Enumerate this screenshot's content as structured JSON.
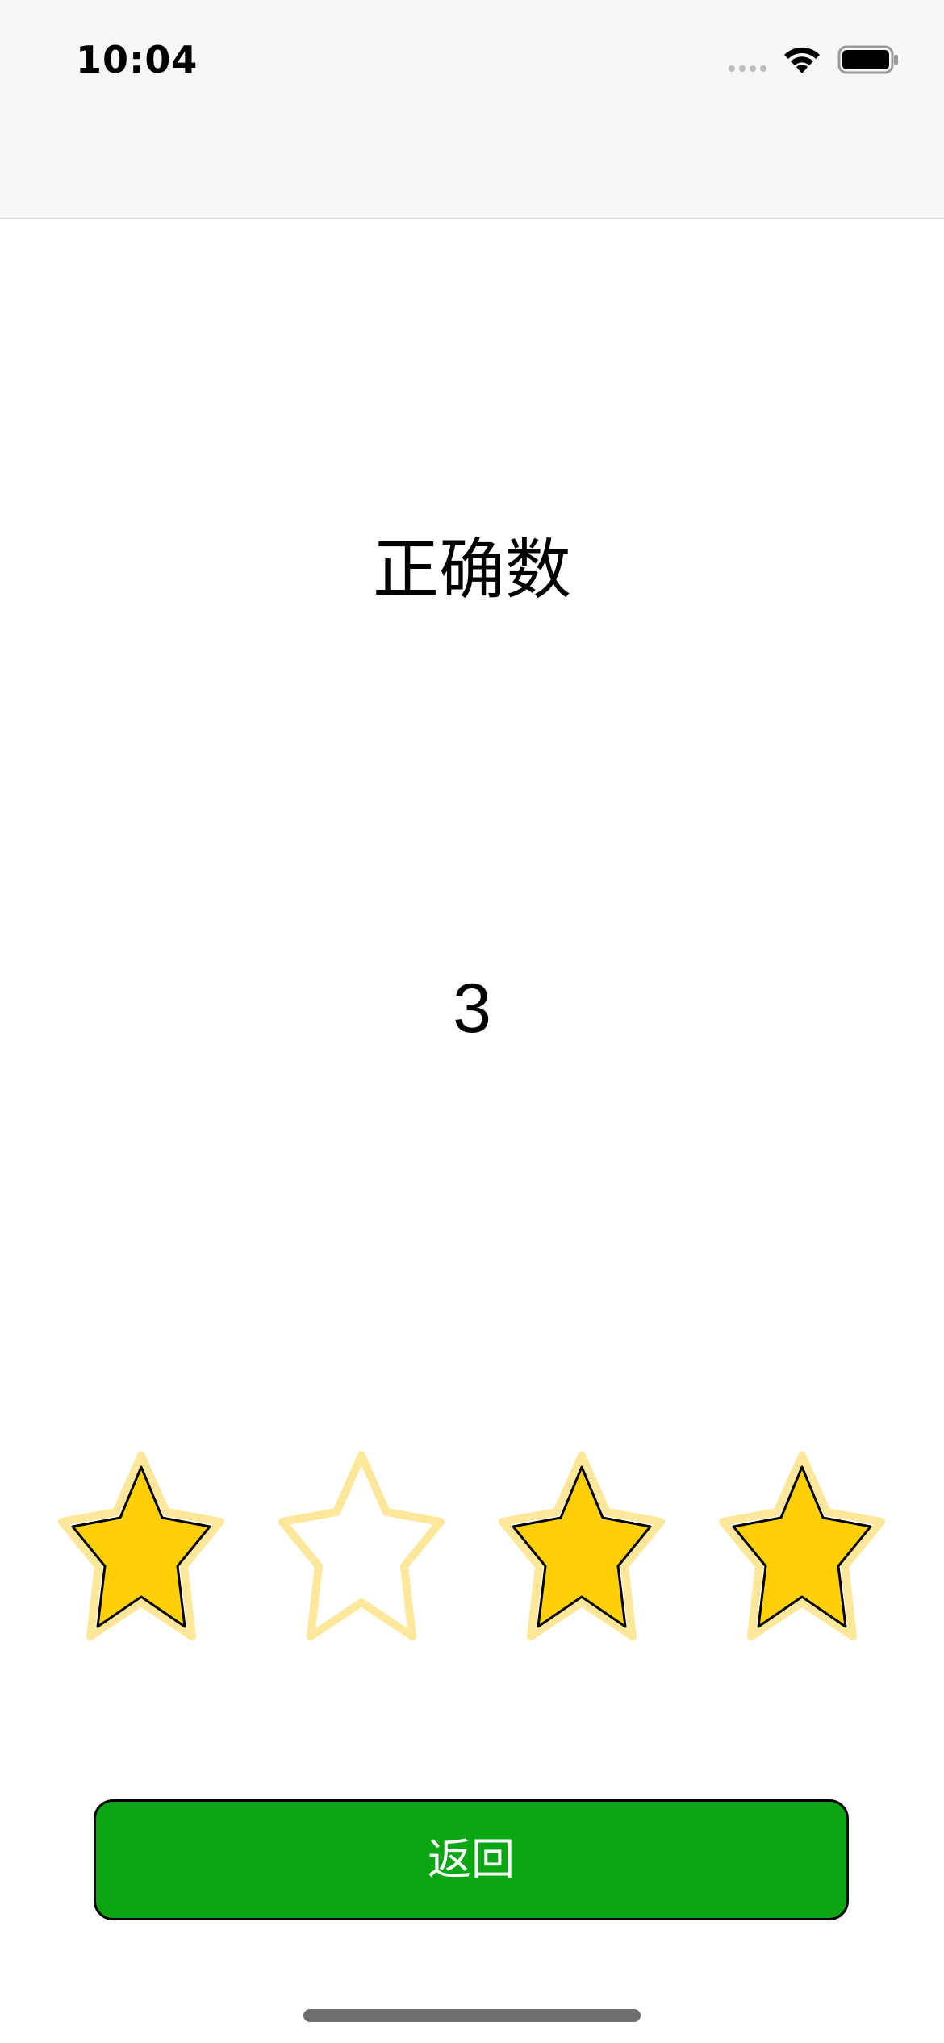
{
  "status_bar": {
    "time": "10:04",
    "icons": [
      "signal-icon",
      "wifi-icon",
      "battery-icon"
    ]
  },
  "result": {
    "title": "正确数",
    "count": "3"
  },
  "stars": {
    "filled_pattern": [
      true,
      false,
      true,
      true
    ],
    "filled_color": "#ffd008",
    "outline_color": "#fde79a"
  },
  "button": {
    "label": "返回",
    "color": "#0aa614"
  }
}
